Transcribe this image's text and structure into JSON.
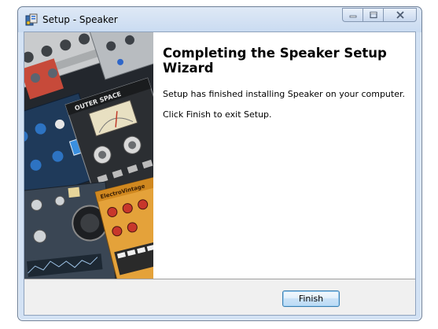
{
  "window": {
    "title": "Setup - Speaker",
    "icons": {
      "app": "setup-installer-icon",
      "minimize": "minimize-icon",
      "maximize": "maximize-icon",
      "close": "close-icon"
    }
  },
  "side_panel": {
    "image": "synthesizer-rack-artwork",
    "device_labels": {
      "outer_space": "OUTER SPACE",
      "electribe": "ElectroVintage"
    }
  },
  "content": {
    "heading": "Completing the Speaker Setup Wizard",
    "line1": "Setup has finished installing Speaker on your computer.",
    "line2": "Click Finish to exit Setup."
  },
  "footer": {
    "finish_label": "Finish"
  },
  "colors": {
    "frame": "#d3e2f4",
    "button_border": "#3c7fb1",
    "footer_bg": "#f0f0f0"
  }
}
